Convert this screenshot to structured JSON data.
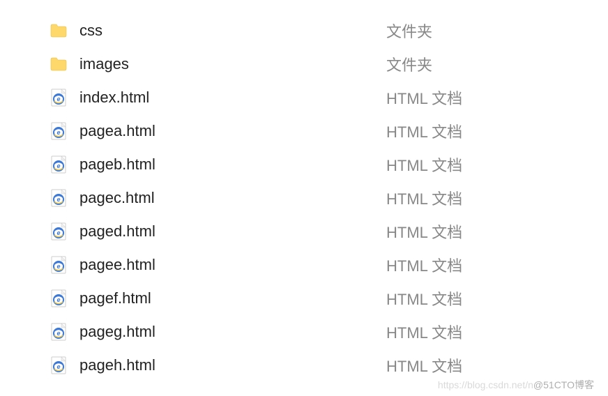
{
  "files": [
    {
      "name": "css",
      "type": "文件夹",
      "icon": "folder"
    },
    {
      "name": "images",
      "type": "文件夹",
      "icon": "folder"
    },
    {
      "name": "index.html",
      "type": "HTML 文档",
      "icon": "html"
    },
    {
      "name": "pagea.html",
      "type": "HTML 文档",
      "icon": "html"
    },
    {
      "name": "pageb.html",
      "type": "HTML 文档",
      "icon": "html"
    },
    {
      "name": "pagec.html",
      "type": "HTML 文档",
      "icon": "html"
    },
    {
      "name": "paged.html",
      "type": "HTML 文档",
      "icon": "html"
    },
    {
      "name": "pagee.html",
      "type": "HTML 文档",
      "icon": "html"
    },
    {
      "name": "pagef.html",
      "type": "HTML 文档",
      "icon": "html"
    },
    {
      "name": "pageg.html",
      "type": "HTML 文档",
      "icon": "html"
    },
    {
      "name": "pageh.html",
      "type": "HTML 文档",
      "icon": "html"
    }
  ],
  "watermark": {
    "light": "https://blog.csdn.net/n",
    "dark": "@51CTO博客"
  }
}
